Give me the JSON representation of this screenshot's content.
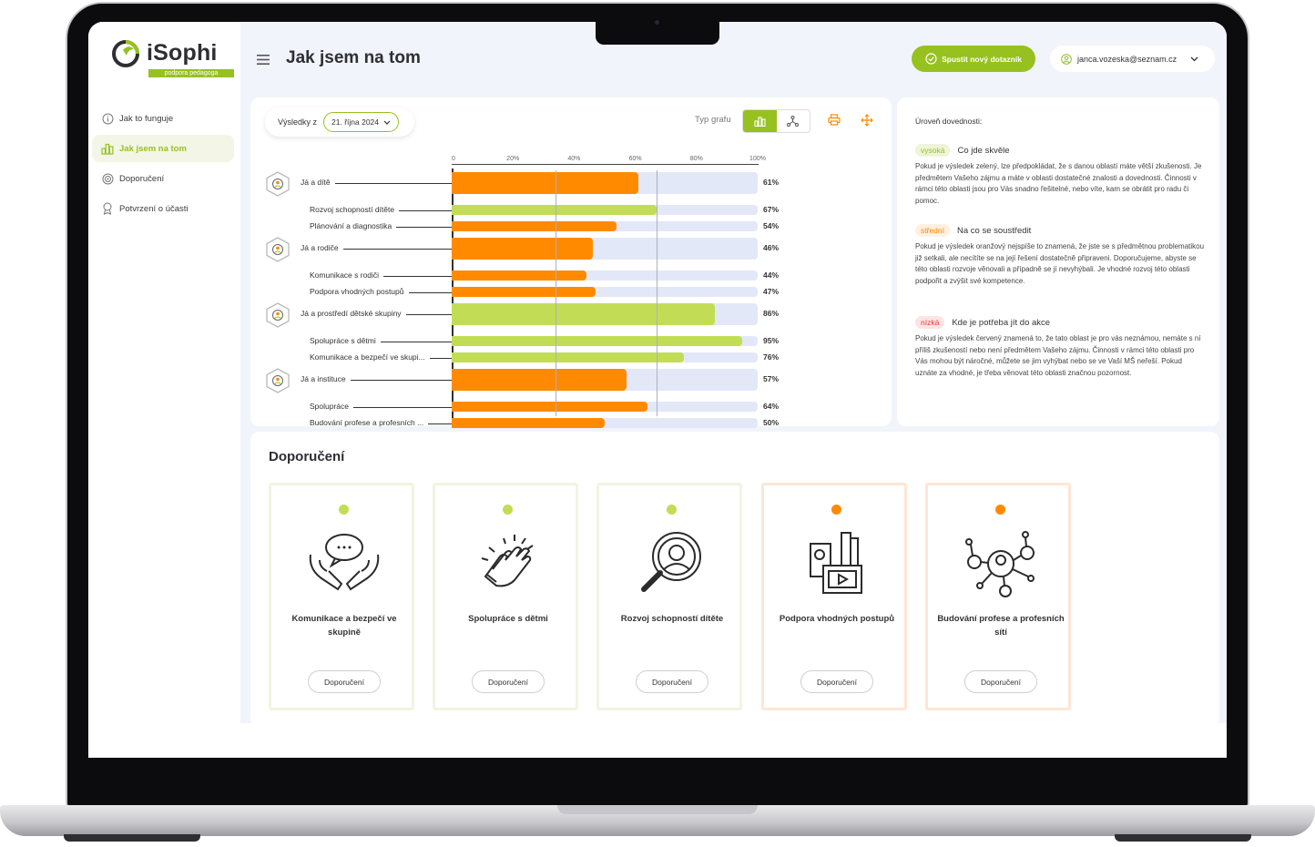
{
  "app": {
    "logo": "iSophi",
    "logo_sub": "podpora pedagoga"
  },
  "sidebar": {
    "items": [
      {
        "label": "Jak to funguje",
        "icon": "info-icon",
        "active": false
      },
      {
        "label": "Jak jsem na tom",
        "icon": "bar-chart-icon",
        "active": true
      },
      {
        "label": "Doporučení",
        "icon": "target-icon",
        "active": false
      },
      {
        "label": "Potvrzení o účasti",
        "icon": "award-icon",
        "active": false
      }
    ]
  },
  "header": {
    "title": "Jak jsem na tom",
    "new_button": "Spustit nový dotazník",
    "user_email": "janca.vozeska@seznam.cz"
  },
  "results": {
    "label": "Výsledky z",
    "date": "21. října 2024"
  },
  "chart_type_label": "Typ grafu",
  "colors": {
    "green": "#96c11f",
    "orange": "#ff8a00",
    "high_bar": "#c2dd55",
    "track": "#e3e8f8",
    "low": "#e53935"
  },
  "chart_data": {
    "type": "bar",
    "orientation": "horizontal",
    "xlim": [
      0,
      100
    ],
    "ticks": [
      "0",
      "20%",
      "40%",
      "60%",
      "80%",
      "100%"
    ],
    "groups": [
      {
        "label": "Já a dítě",
        "value": 61,
        "pct": "61%",
        "level": "medium",
        "items": [
          {
            "label": "Rozvoj schopností dítěte",
            "value": 67,
            "pct": "67%",
            "level": "high"
          },
          {
            "label": "Plánování a diagnostika",
            "value": 54,
            "pct": "54%",
            "level": "medium"
          }
        ]
      },
      {
        "label": "Já a rodiče",
        "value": 46,
        "pct": "46%",
        "level": "medium",
        "items": [
          {
            "label": "Komunikace s rodiči",
            "value": 44,
            "pct": "44%",
            "level": "medium"
          },
          {
            "label": "Podpora vhodných postupů",
            "value": 47,
            "pct": "47%",
            "level": "medium"
          }
        ]
      },
      {
        "label": "Já a prostředí dětské skupiny",
        "value": 86,
        "pct": "86%",
        "level": "high",
        "items": [
          {
            "label": "Spolupráce s dětmi",
            "value": 95,
            "pct": "95%",
            "level": "high"
          },
          {
            "label": "Komunikace a bezpečí ve skupi...",
            "value": 76,
            "pct": "76%",
            "level": "high"
          }
        ]
      },
      {
        "label": "Já a instituce",
        "value": 57,
        "pct": "57%",
        "level": "medium",
        "items": [
          {
            "label": "Spolupráce",
            "value": 64,
            "pct": "64%",
            "level": "medium"
          },
          {
            "label": "Budování profese a profesních ...",
            "value": 50,
            "pct": "50%",
            "level": "medium"
          }
        ]
      }
    ]
  },
  "legend": {
    "title": "Úroveň dovednosti:",
    "levels": [
      {
        "badge": "vysoká",
        "heading": "Co jde skvěle",
        "text": "Pokud je výsledek zelený, lze předpokládat, že s danou oblastí máte větší zkušenosti. Je předmětem Vašeho zájmu a máte v oblasti dostatečné znalosti a dovednosti. Činnosti v rámci této oblasti jsou pro Vás snadno řešitelné, nebo víte, kam se obrátit pro radu či pomoc."
      },
      {
        "badge": "střední",
        "heading": "Na co se soustředit",
        "text": "Pokud je výsledek oranžový nejspíše to znamená, že jste se s předmětnou problematikou již setkali, ale necítíte se na její řešení dostatečně připraveni. Doporučujeme, abyste se této oblasti rozvoje věnovali a případně se jí nevyhýbali. Je vhodné rozvoj této oblasti podpořit a zvýšit své kompetence."
      },
      {
        "badge": "nízká",
        "heading": "Kde je potřeba jít do akce",
        "text": "Pokud je výsledek červený znamená to, že tato oblast je pro vás neznámou, nemáte s ní příliš zkušeností nebo není předmětem Vašeho zájmu. Činnosti v rámci této oblasti pro Vás mohou být náročné, můžete se jim vyhýbat nebo se ve Vaší MŠ neřeší. Pokud uznáte za vhodné, je třeba věnovat této oblasti značnou pozornost."
      }
    ]
  },
  "recommendations": {
    "title": "Doporučení",
    "cards": [
      {
        "title": "Komunikace a bezpečí ve skupině",
        "level": "high",
        "button": "Doporučení",
        "icon": "hands-speech-icon"
      },
      {
        "title": "Spolupráce s dětmi",
        "level": "high",
        "button": "Doporučení",
        "icon": "clapping-hands-icon"
      },
      {
        "title": "Rozvoj schopností dítěte",
        "level": "high",
        "button": "Doporučení",
        "icon": "magnifier-child-icon"
      },
      {
        "title": "Podpora vhodných postupů",
        "level": "medium",
        "button": "Doporučení",
        "icon": "media-files-icon"
      },
      {
        "title": "Budování profese a profesních sítí",
        "level": "medium",
        "button": "Doporučení",
        "icon": "network-people-icon"
      }
    ]
  }
}
